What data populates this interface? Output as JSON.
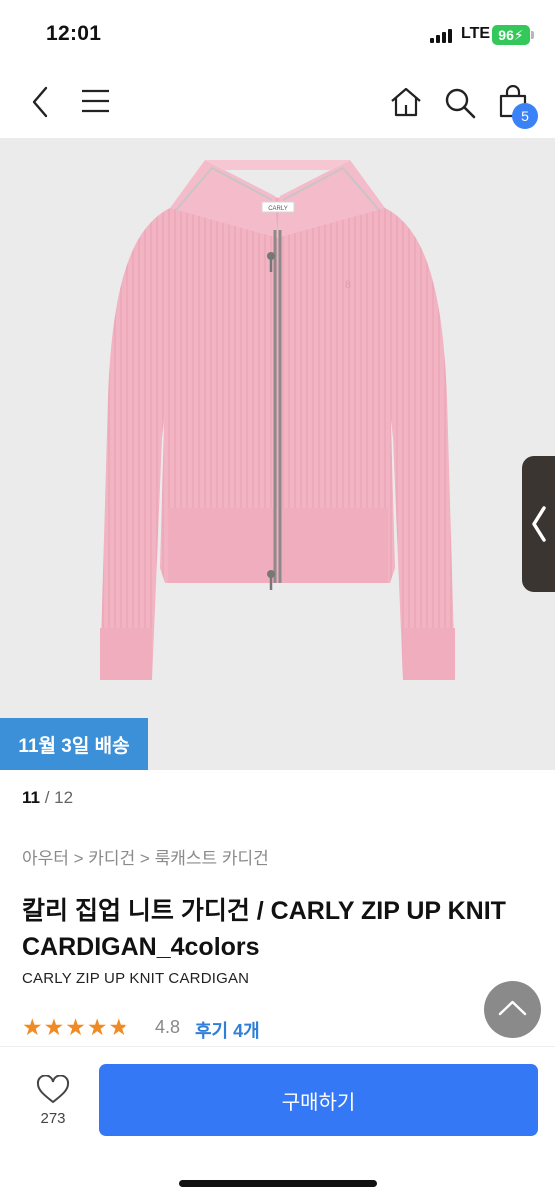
{
  "status_bar": {
    "time": "12:01",
    "network": "LTE",
    "battery": "96"
  },
  "nav": {
    "cart_count": "5",
    "icons": [
      "back-icon",
      "menu-icon",
      "home-icon",
      "search-icon",
      "shopping-bag-icon"
    ]
  },
  "product": {
    "delivery_badge": "11월 3일 배송",
    "pager_current": "11",
    "pager_total": "/ 12",
    "breadcrumb": "아우터 > 카디건 > 룩캐스트 카디건",
    "title": "칼리 집업 니트 가디건 / CARLY ZIP UP KNIT CARDIGAN_4colors",
    "subtitle": "CARLY ZIP UP KNIT CARDIGAN",
    "rating": "4.8",
    "rating_fraction": 0.96,
    "review_link": "후기 4개",
    "label_tag": "CARLY"
  },
  "bottom_bar": {
    "like_count": "273",
    "buy_label": "구매하기"
  },
  "colors": {
    "accent": "#3478f6",
    "badge": "#3b90d8",
    "star": "#f08a24",
    "cardigan": "#f2b3c3"
  }
}
